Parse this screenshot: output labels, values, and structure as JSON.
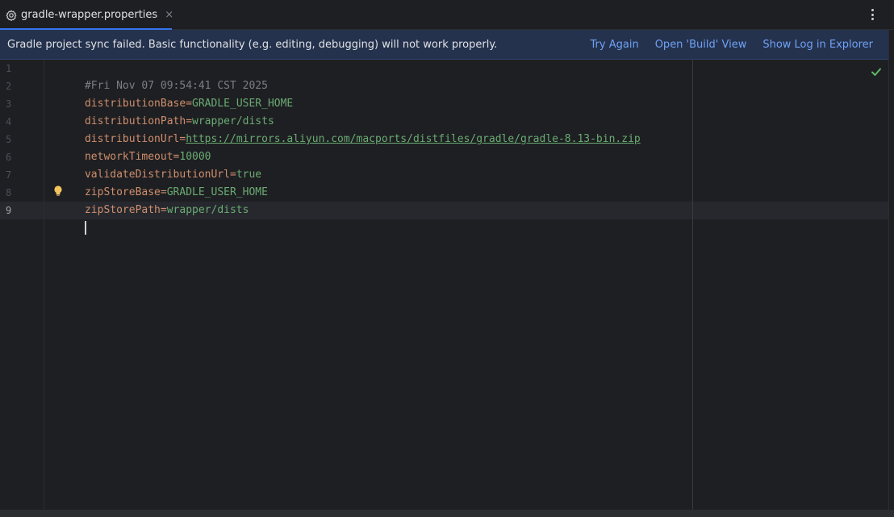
{
  "tab": {
    "icon": "gear-icon",
    "label": "gradle-wrapper.properties",
    "close": "×"
  },
  "banner": {
    "message": "Gradle project sync failed. Basic functionality (e.g. editing, debugging) will not work properly.",
    "actions": [
      "Try Again",
      "Open 'Build' View",
      "Show Log in Explorer"
    ]
  },
  "editor": {
    "current_line": 9,
    "line_numbers": [
      "1",
      "2",
      "3",
      "4",
      "5",
      "6",
      "7",
      "8",
      "9"
    ],
    "lines": [
      {
        "comment": "#Fri Nov 07 09:54:41 CST 2025"
      },
      {
        "key": "distributionBase",
        "value": "GRADLE_USER_HOME"
      },
      {
        "key": "distributionPath",
        "value": "wrapper/dists"
      },
      {
        "key": "distributionUrl",
        "value": "https://mirrors.aliyun.com/macports/distfiles/gradle/gradle-8.13-bin.zip",
        "is_url": true
      },
      {
        "key": "networkTimeout",
        "value": "10000"
      },
      {
        "key": "validateDistributionUrl",
        "value": "true"
      },
      {
        "key": "zipStoreBase",
        "value": "GRADLE_USER_HOME"
      },
      {
        "key": "zipStorePath",
        "value": "wrapper/dists"
      },
      {
        "key": "",
        "value": ""
      }
    ],
    "inspection_status": "check-icon"
  },
  "colors": {
    "accent": "#3574f0",
    "banner_bg": "#25324d",
    "link": "#6ea2f7",
    "key": "#cf8e6d",
    "value": "#6aab73",
    "comment": "#7a7e85"
  }
}
